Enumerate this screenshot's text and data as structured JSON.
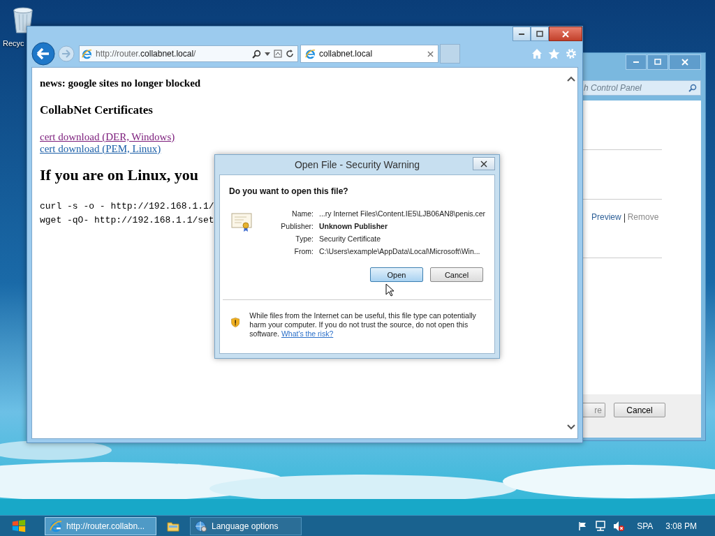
{
  "desktop": {
    "icons": [
      {
        "label": "Recyc"
      }
    ]
  },
  "control_panel_window": {
    "search": {
      "placeholder": "h Control Panel"
    },
    "links": [
      {
        "label": "Preview",
        "disabled": false
      },
      {
        "label": "Remove",
        "disabled": true
      }
    ],
    "buttons": [
      {
        "label": "re",
        "default": false
      },
      {
        "label": "Cancel",
        "default": false
      }
    ]
  },
  "browser": {
    "address": {
      "scheme": "http://router.",
      "host": "collabnet.local",
      "path": "/"
    },
    "tabs": [
      {
        "title": "collabnet.local",
        "selected": true
      }
    ],
    "page": {
      "news": "news: google sites no longer blocked",
      "heading": "CollabNet Certificates",
      "links": [
        {
          "label": "cert download (DER, Windows)",
          "visited": true
        },
        {
          "label": "cert download (PEM, Linux)",
          "visited": false
        }
      ],
      "big_heading": "If you are on Linux, you",
      "code": [
        "curl -s -o - http://192.168.1.1/",
        "wget -qO- http://192.168.1.1/set"
      ]
    }
  },
  "dialog": {
    "title": "Open File - Security Warning",
    "question": "Do you want to open this file?",
    "fields": [
      {
        "label": "Name:",
        "value": "...ry Internet Files\\Content.IE5\\LJB06AN8\\penis.cer",
        "bold": false
      },
      {
        "label": "Publisher:",
        "value": "Unknown Publisher",
        "bold": true
      },
      {
        "label": "Type:",
        "value": "Security Certificate",
        "bold": false
      },
      {
        "label": "From:",
        "value": "C:\\Users\\example\\AppData\\Local\\Microsoft\\Win...",
        "bold": false
      }
    ],
    "buttons": [
      {
        "label": "Open",
        "default": true
      },
      {
        "label": "Cancel",
        "default": false
      }
    ],
    "warning": {
      "text": "While files from the Internet can be useful, this file type can potentially harm your computer. If you do not trust the source, do not open this software.",
      "link": "What's the risk?"
    }
  },
  "taskbar": {
    "items": [
      {
        "kind": "browser",
        "label": "http://router.collabn...",
        "selected": true
      },
      {
        "kind": "folder",
        "selected": false
      },
      {
        "kind": "language",
        "label": "Language options",
        "selected": false
      }
    ],
    "tray": {
      "language": "SPA",
      "time": "3:08 PM"
    }
  }
}
